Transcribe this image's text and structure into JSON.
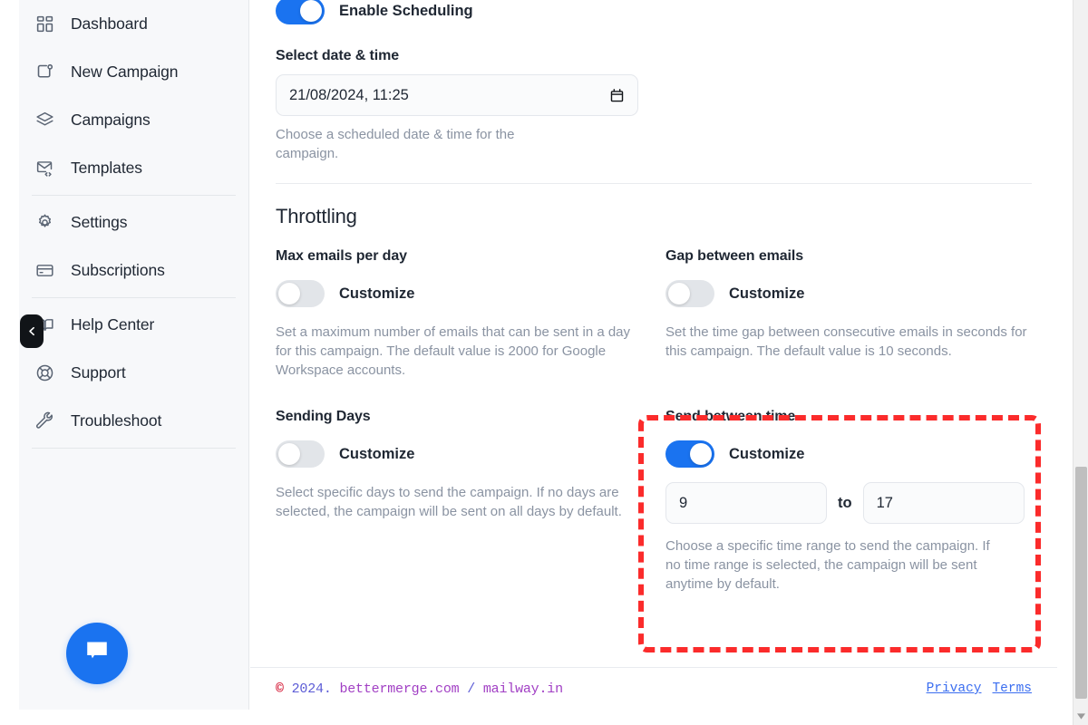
{
  "sidebar": {
    "items": [
      {
        "label": "Dashboard",
        "icon": "dashboard-grid-icon"
      },
      {
        "label": "New Campaign",
        "icon": "new-campaign-icon"
      },
      {
        "label": "Campaigns",
        "icon": "layers-icon"
      },
      {
        "label": "Templates",
        "icon": "mail-code-icon"
      },
      {
        "label": "Settings",
        "icon": "gear-icon"
      },
      {
        "label": "Subscriptions",
        "icon": "credit-card-icon"
      },
      {
        "label": "Help Center",
        "icon": "book-open-icon"
      },
      {
        "label": "Support",
        "icon": "lifebuoy-icon"
      },
      {
        "label": "Troubleshoot",
        "icon": "wrench-icon"
      }
    ],
    "collapse_icon": "chevron-left-icon",
    "chat_icon": "chat-bubble-icon"
  },
  "scheduling": {
    "enable_toggle_label": "Enable Scheduling",
    "enable_toggle_on": true,
    "date_label": "Select date & time",
    "date_value": "21/08/2024, 11:25",
    "date_icon": "calendar-icon",
    "date_helper": "Choose a scheduled date & time for the campaign."
  },
  "throttling": {
    "title": "Throttling",
    "cards": [
      {
        "title": "Max emails per day",
        "toggle_label": "Customize",
        "toggle_on": false,
        "helper": "Set a maximum number of emails that can be sent in a day for this campaign. The default value is 2000 for Google Workspace accounts."
      },
      {
        "title": "Gap between emails",
        "toggle_label": "Customize",
        "toggle_on": false,
        "helper": "Set the time gap between consecutive emails in seconds for this campaign. The default value is 10 seconds."
      },
      {
        "title": "Sending Days",
        "toggle_label": "Customize",
        "toggle_on": false,
        "helper": "Select specific days to send the campaign. If no days are selected, the campaign will be sent on all days by default."
      },
      {
        "title": "Send between time",
        "toggle_label": "Customize",
        "toggle_on": true,
        "from_value": "9",
        "to_separator": "to",
        "to_value": "17",
        "helper": "Choose a specific time range to send the campaign. If no time range is selected, the campaign will be sent anytime by default."
      }
    ]
  },
  "footer": {
    "copyright_symbol": "©",
    "year": " 2024. ",
    "brand_primary": "bettermerge.com",
    "separator": " / ",
    "brand_secondary": "mailway.in",
    "privacy": "Privacy",
    "terms": "Terms"
  },
  "colors": {
    "accent_blue": "#1a73f0",
    "highlight_red": "#fb2b2b",
    "toggle_off": "#e2e5e9",
    "text_dark": "#1f2733",
    "text_muted": "#8a93a2"
  }
}
